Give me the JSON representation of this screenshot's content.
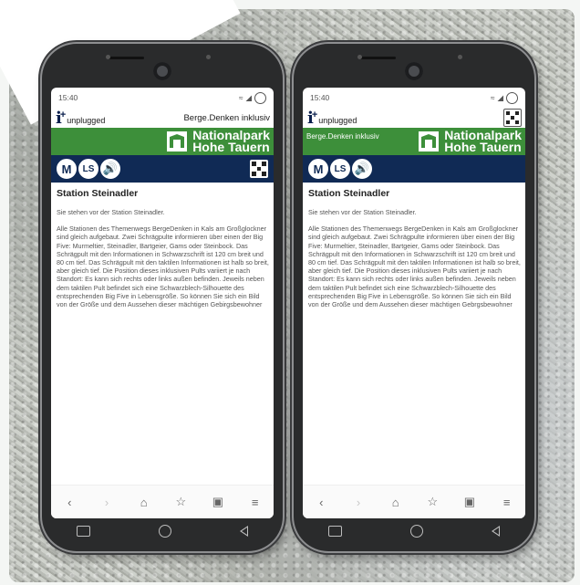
{
  "phones": [
    {
      "status_time": "15:40",
      "brand_text": "unplugged",
      "header_right": "Berge.Denken inklusiv",
      "green_left": "",
      "np_line1": "Nationalpark",
      "np_line2": "Hohe Tauern",
      "badge_m": "M",
      "badge_ls": "LS",
      "title": "Station Steinadler",
      "intro": "Sie stehen vor der Station Steinadler.",
      "body": "Alle Stationen des Themenwegs BergeDenken in Kals am Großglockner sind gleich aufgebaut. Zwei Schrägpulte informieren über einen der Big Five: Murmeltier, Steinadler, Bartgeier, Gams oder Steinbock. Das Schrägpult mit den Informationen in Schwarzschrift ist 120 cm breit und 80 cm tief. Das Schrägpult mit den taktilen Informationen ist halb so breit, aber gleich tief. Die Position dieses inklusiven Pults variiert je nach Standort: Es kann sich rechts oder links außen befinden. Jeweils neben dem taktilen Pult befindet sich eine Schwarzblech-Silhouette des entsprechenden Big Five in Lebensgröße. So können Sie sich ein Bild von der Größe und dem Aussehen dieser mächtigen Gebirgsbewohner"
    },
    {
      "status_time": "15:40",
      "brand_text": "unplugged",
      "header_right": "",
      "green_left": "Berge.Denken inklusiv",
      "np_line1": "Nationalpark",
      "np_line2": "Hohe Tauern",
      "badge_m": "M",
      "badge_ls": "LS",
      "title": "Station Steinadler",
      "intro": "Sie stehen vor der Station Steinadler.",
      "body": "Alle Stationen des Themenwegs BergeDenken in Kals am Großglockner sind gleich aufgebaut. Zwei Schrägpulte informieren über einen der Big Five: Murmeltier, Steinadler, Bartgeier, Gams oder Steinbock. Das Schrägpult mit den Informationen in Schwarzschrift ist 120 cm breit und 80 cm tief. Das Schrägpult mit den taktilen Informationen ist halb so breit, aber gleich tief. Die Position dieses inklusiven Pults variiert je nach Standort: Es kann sich rechts oder links außen befinden. Jeweils neben dem taktilen Pult befindet sich eine Schwarzblech-Silhouette des entsprechenden Big Five in Lebensgröße. So können Sie sich ein Bild von der Größe und dem Aussehen dieser mächtigen Gebrgsbewohner"
    }
  ],
  "browser_icons": [
    "back-arrow",
    "forward-arrow",
    "home-icon",
    "bookmark-star-icon",
    "tabs-icon",
    "menu-icon"
  ],
  "colors": {
    "green": "#3d8f3a",
    "navy": "#102a55"
  }
}
